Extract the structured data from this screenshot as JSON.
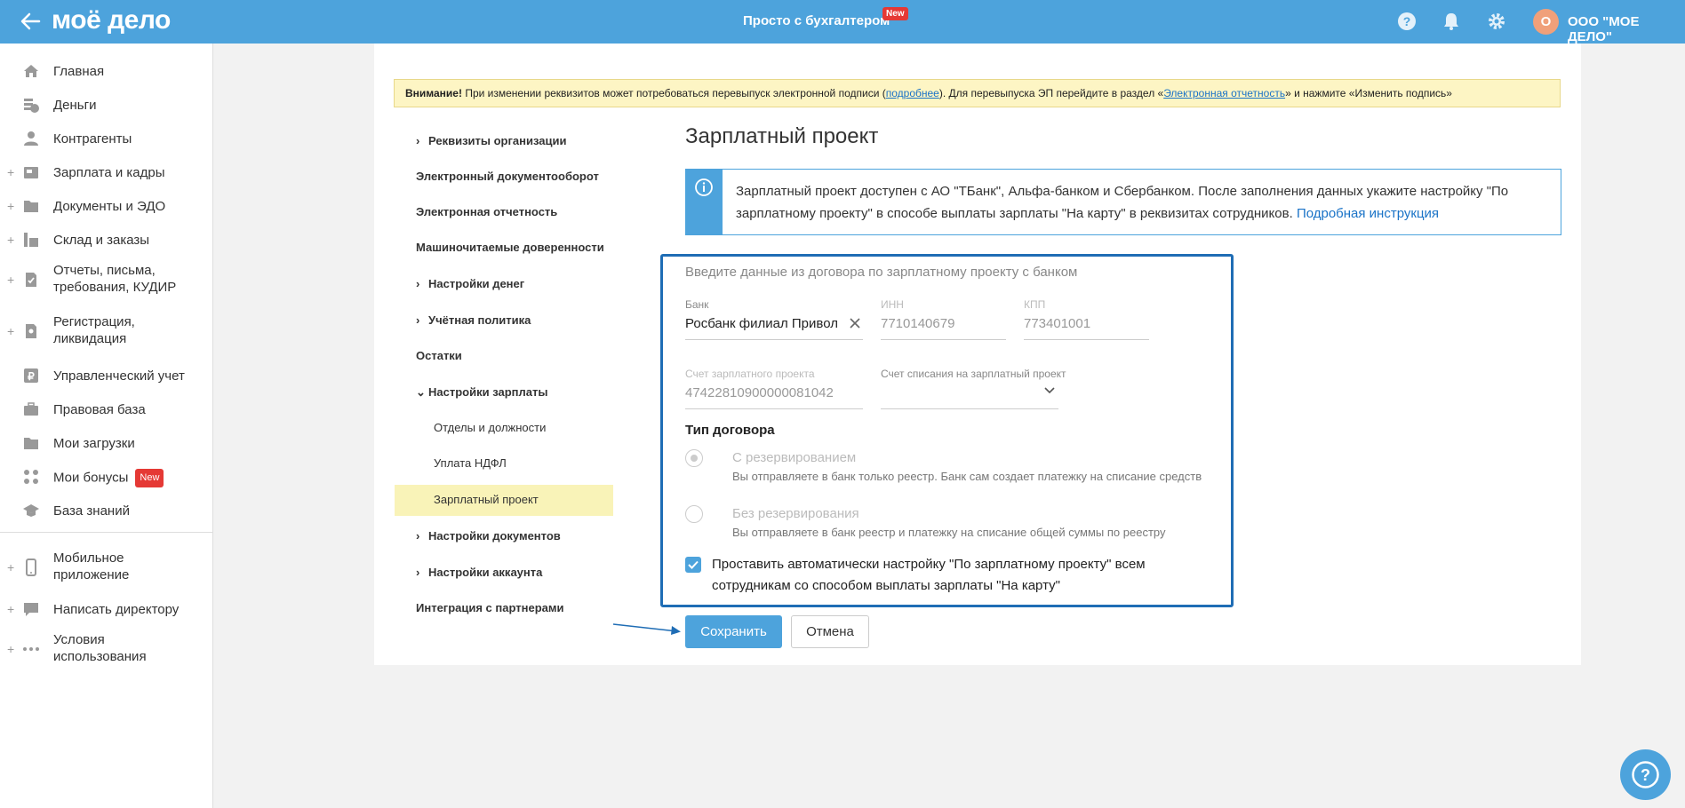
{
  "header": {
    "logo": "моё дело",
    "center_title": "Просто с бухгалтером",
    "new_tag": "New",
    "org_initial": "О",
    "org_name": "ООО \"МОЕ ДЕЛО\"",
    "icons": [
      "back-arrow-icon",
      "help-icon",
      "bell-icon",
      "gear-icon"
    ]
  },
  "sidebar": {
    "items": [
      {
        "label": "Главная",
        "icon": "home-icon",
        "plus": false
      },
      {
        "label": "Деньги",
        "icon": "money-icon",
        "plus": false
      },
      {
        "label": "Контрагенты",
        "icon": "contacts-icon",
        "plus": false
      },
      {
        "label": "Зарплата и кадры",
        "icon": "salary-icon",
        "plus": true
      },
      {
        "label": "Документы и ЭДО",
        "icon": "folder-icon",
        "plus": true
      },
      {
        "label": "Склад и заказы",
        "icon": "warehouse-icon",
        "plus": true
      },
      {
        "label": "Отчеты, письма, требования, КУДИР",
        "icon": "report-icon",
        "plus": true
      },
      {
        "label": "Регистрация, ликвидация",
        "icon": "registration-icon",
        "plus": true
      },
      {
        "label": "Управленческий учет",
        "icon": "ruble-icon",
        "plus": false
      },
      {
        "label": "Правовая база",
        "icon": "briefcase-icon",
        "plus": false
      },
      {
        "label": "Мои загрузки",
        "icon": "folder-icon",
        "plus": false
      },
      {
        "label": "Мои бонусы",
        "icon": "bonus-icon",
        "plus": false,
        "badge": "New"
      },
      {
        "label": "База знаний",
        "icon": "graduation-icon",
        "plus": false
      },
      {
        "label": "Мобильное приложение",
        "icon": "mobile-icon",
        "plus": true
      },
      {
        "label": "Написать директору",
        "icon": "chat-icon",
        "plus": true
      },
      {
        "label": "Условия использования",
        "icon": "dots-icon",
        "plus": true
      }
    ]
  },
  "warning": {
    "bold": "Внимание!",
    "text1": " При изменении реквизитов может потребоваться перевыпуск электронной подписи (",
    "link1": "подробнее",
    "text2": "). Для перевыпуска ЭП перейдите в раздел «",
    "link2": "Электронная отчетность",
    "text3": "» и нажмите «Изменить подпись»"
  },
  "settings_menu": {
    "items": [
      {
        "label": "Реквизиты организации",
        "chevron": "right"
      },
      {
        "label": "Электронный документооборот"
      },
      {
        "label": "Электронная отчетность"
      },
      {
        "label": "Машиночитаемые доверенности"
      },
      {
        "label": "Настройки денег",
        "chevron": "right"
      },
      {
        "label": "Учётная политика",
        "chevron": "right"
      },
      {
        "label": "Остатки"
      },
      {
        "label": "Настройки зарплаты",
        "chevron": "down"
      },
      {
        "label": "Отделы и должности",
        "sub": true
      },
      {
        "label": "Уплата НДФЛ",
        "sub": true
      },
      {
        "label": "Зарплатный проект",
        "sub": true,
        "active": true
      },
      {
        "label": "Настройки документов",
        "chevron": "right"
      },
      {
        "label": "Настройки аккаунта",
        "chevron": "right"
      },
      {
        "label": "Интеграция с партнерами"
      }
    ]
  },
  "page": {
    "title": "Зарплатный проект",
    "info_text": "Зарплатный проект доступен с АО \"ТБанк\", Альфа-банком и Сбербанком. После заполнения данных укажите настройку \"По зарплатному проекту\" в способе выплаты зарплаты \"На карту\" в реквизитах сотрудников. ",
    "info_link": "Подробная инструкция"
  },
  "form": {
    "hint": "Введите данные из договора по зарплатному проекту с банком",
    "bank_label": "Банк",
    "bank_value": "Росбанк филиал Привол",
    "inn_label": "ИНН",
    "inn_value": "7710140679",
    "kpp_label": "КПП",
    "kpp_value": "773401001",
    "account_label": "Счет зарплатного проекта",
    "account_value": "47422810900000081042",
    "debit_label": "Счет списания на зарплатный проект",
    "debit_value": "",
    "contract_title": "Тип договора",
    "radio1_title": "С резервированием",
    "radio1_desc": "Вы отправляете в банк только реестр. Банк сам создает платежку на списание средств",
    "radio1_checked": true,
    "radio2_title": "Без резервирования",
    "radio2_desc": "Вы отправляете в банк реестр и платежку на списание общей суммы по реестру",
    "radio2_checked": false,
    "checkbox_label": "Проставить автоматически настройку \"По зарплатному проекту\" всем сотрудникам со способом выплаты зарплаты \"На карту\"",
    "checkbox_checked": true
  },
  "buttons": {
    "save": "Сохранить",
    "cancel": "Отмена"
  },
  "colors": {
    "accent": "#4da3dc",
    "warning_bg": "#fdf5c4",
    "active_menu_bg": "#f9f3b8",
    "badge_red": "#e53935",
    "form_border": "#1f6db5"
  }
}
